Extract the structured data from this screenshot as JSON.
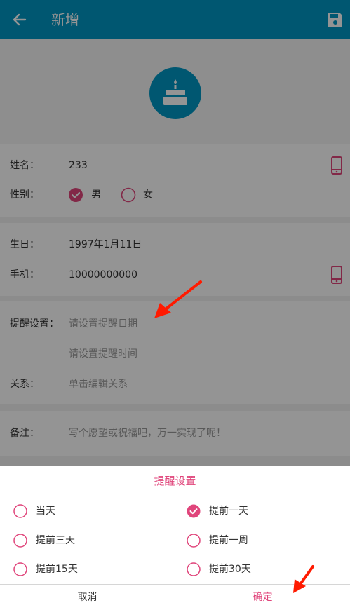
{
  "toolbar": {
    "title": "新增",
    "back_icon": "arrow-left-icon",
    "save_icon": "save-icon"
  },
  "avatar": {
    "icon": "cake-icon"
  },
  "form": {
    "name_label": "姓名：",
    "name_value": "233",
    "gender_label": "性别：",
    "gender_male": "男",
    "gender_female": "女",
    "gender_selected": "男",
    "birthday_label": "生日：",
    "birthday_value": "1997年1月11日",
    "phone_label": "手机：",
    "phone_value": "10000000000",
    "reminder_label": "提醒设置：",
    "reminder_date_placeholder": "请设置提醒日期",
    "reminder_time_placeholder": "请设置提醒时间",
    "relation_label": "关系：",
    "relation_placeholder": "单击编辑关系",
    "note_label": "备注：",
    "note_placeholder": "写个愿望或祝福吧，万一实现了呢！"
  },
  "dialog": {
    "title": "提醒设置",
    "options": [
      {
        "label": "当天",
        "checked": false
      },
      {
        "label": "提前一天",
        "checked": true
      },
      {
        "label": "提前三天",
        "checked": false
      },
      {
        "label": "提前一周",
        "checked": false
      },
      {
        "label": "提前15天",
        "checked": false
      },
      {
        "label": "提前30天",
        "checked": false
      }
    ],
    "cancel_label": "取消",
    "confirm_label": "确定"
  },
  "colors": {
    "primary": "#0097c3",
    "accent": "#e0457b",
    "annotation": "#ff1a00"
  }
}
